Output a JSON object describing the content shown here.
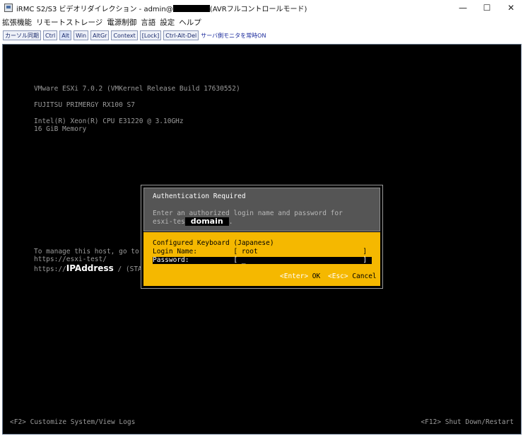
{
  "window": {
    "title_prefix": "iRMC S2/S3 ビデオリダイレクション - admin@",
    "title_suffix": "(AVRフルコントロールモード)",
    "controls": {
      "minimize": "—",
      "maximize": "☐",
      "close": "✕"
    }
  },
  "menu": {
    "items": [
      "拡張機能",
      "リモートストレージ",
      "電源制御",
      "言語",
      "設定",
      "ヘルプ"
    ]
  },
  "toolbar": {
    "buttons": [
      "カーソル同期",
      "Ctrl",
      "Alt",
      "Win",
      "AltGr",
      "Context",
      "[Lock]",
      "Ctrl-Alt-Del"
    ],
    "link": "サーバ側モニタを常時ON"
  },
  "console": {
    "lines": [
      "VMware ESXi 7.0.2 (VMKernel Release Build 17630552)",
      "FUJITSU PRIMERGY RX100 S7",
      "Intel(R) Xeon(R) CPU E31220 @ 3.10GHz",
      "16 GiB Memory",
      "To manage this host, go to",
      "https://esxi-test/",
      "https://",
      "IPAddress",
      " / (STA"
    ],
    "footer_left": "<F2> Customize System/View Logs",
    "footer_right": "<F12> Shut Down/Restart"
  },
  "dialog": {
    "title": "Authentication Required",
    "prompt_line1": "Enter an authorized login name and password for",
    "prompt_line2": "esxi-tes",
    "domain_label": "domain",
    "prompt_end": ".",
    "keyboard": "Configured Keyboard (Japanese)",
    "login_line": "Login Name:         [ root                          ]",
    "password_line": "Password:           [ _                             ]",
    "ok_key": "<Enter>",
    "ok_label": " OK",
    "cancel_key": "<Esc>",
    "cancel_label": " Cancel"
  }
}
